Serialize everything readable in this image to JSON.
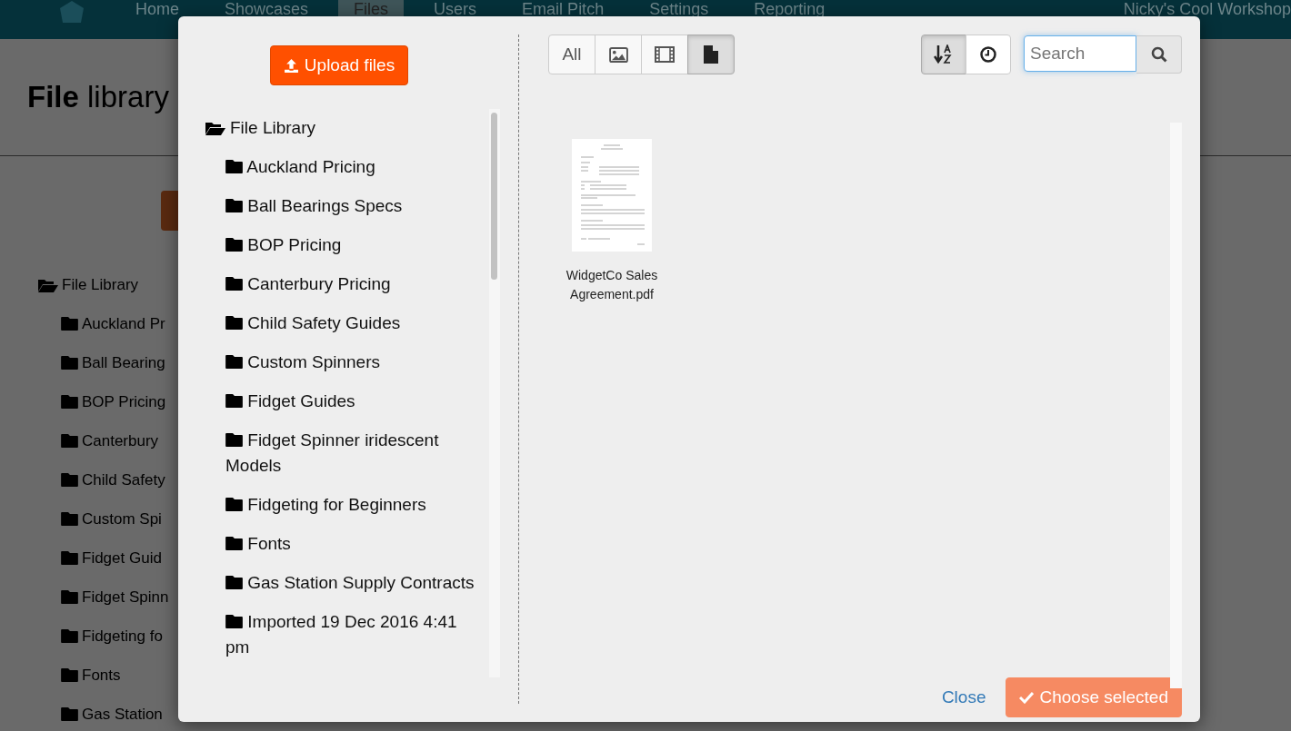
{
  "navbar": {
    "items": [
      {
        "label": "Home",
        "selected": false
      },
      {
        "label": "Showcases",
        "selected": false
      },
      {
        "label": "Files",
        "selected": true
      },
      {
        "label": "Users",
        "selected": false
      },
      {
        "label": "Email Pitch",
        "selected": false
      },
      {
        "label": "Settings",
        "selected": false
      },
      {
        "label": "Reporting",
        "selected": false
      }
    ],
    "account": "Nicky's Cool Workshop"
  },
  "page": {
    "title": "**File** library",
    "tree": {
      "label": "File Library",
      "expanded": true,
      "children": [
        {
          "label": "Auckland Pr"
        },
        {
          "label": "Ball Bearing"
        },
        {
          "label": "BOP Pricing"
        },
        {
          "label": "Canterbury"
        },
        {
          "label": "Child Safety"
        },
        {
          "label": "Custom Spi"
        },
        {
          "label": "Fidget Guid"
        },
        {
          "label": "Fidget Spinn"
        },
        {
          "label": "Fidgeting fo"
        },
        {
          "label": "Fonts"
        },
        {
          "label": "Gas Station"
        }
      ]
    }
  },
  "modal": {
    "upload_button": "Upload files",
    "tree": {
      "label": "File Library",
      "expanded": true,
      "children": [
        {
          "label": "Auckland Pricing"
        },
        {
          "label": "Ball Bearings Specs"
        },
        {
          "label": "BOP Pricing"
        },
        {
          "label": "Canterbury Pricing"
        },
        {
          "label": "Child Safety Guides"
        },
        {
          "label": "Custom Spinners"
        },
        {
          "label": "Fidget Guides"
        },
        {
          "label": "Fidget Spinner iridescent Models"
        },
        {
          "label": "Fidgeting for Beginners"
        },
        {
          "label": "Fonts"
        },
        {
          "label": "Gas Station Supply Contracts"
        },
        {
          "label": "Imported 19 Dec 2016 4:41 pm"
        }
      ]
    },
    "filters": [
      {
        "kind": "all",
        "label": "All",
        "selected": false
      },
      {
        "kind": "image",
        "selected": false
      },
      {
        "kind": "video",
        "selected": false
      },
      {
        "kind": "document",
        "selected": true
      }
    ],
    "sort": [
      {
        "kind": "alpha",
        "selected": true
      },
      {
        "kind": "recent",
        "selected": false
      }
    ],
    "search": {
      "placeholder": "Search"
    },
    "files": [
      {
        "name": "WidgetCo Sales Agreement.pdf",
        "selected": false
      }
    ],
    "close_link": "Close",
    "choose_button": {
      "label": "Choose selected",
      "disabled": true
    }
  }
}
